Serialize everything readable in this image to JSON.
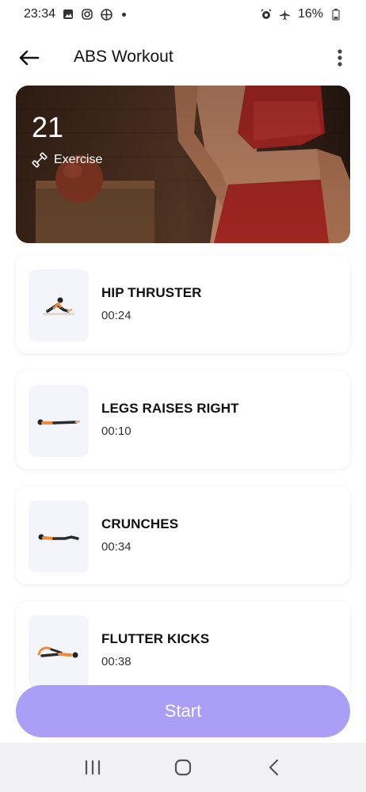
{
  "status_bar": {
    "time": "23:34",
    "battery": "16%",
    "left_icons": [
      "image-icon",
      "instagram-icon",
      "app-icon",
      "dot-icon"
    ],
    "right_icons": [
      "alarm-icon",
      "airplane-icon",
      "battery-icon"
    ]
  },
  "app_bar": {
    "title": "ABS Workout",
    "back_icon": "arrow-left-icon",
    "more_icon": "more-vertical-icon"
  },
  "hero": {
    "count": "21",
    "label": "Exercise",
    "label_icon": "dumbbell-icon"
  },
  "exercises": [
    {
      "name": "HIP THRUSTER",
      "time": "00:24"
    },
    {
      "name": "LEGS RAISES RIGHT",
      "time": "00:10"
    },
    {
      "name": "CRUNCHES",
      "time": "00:34"
    },
    {
      "name": "FLUTTER KICKS",
      "time": "00:38"
    }
  ],
  "start_button": {
    "label": "Start"
  },
  "colors": {
    "accent": "#aa9ef7",
    "thumb_bg": "#f4f5fa",
    "nav_bg": "#f2f2f4"
  },
  "nav": [
    "recent-apps-icon",
    "home-icon",
    "back-nav-icon"
  ]
}
